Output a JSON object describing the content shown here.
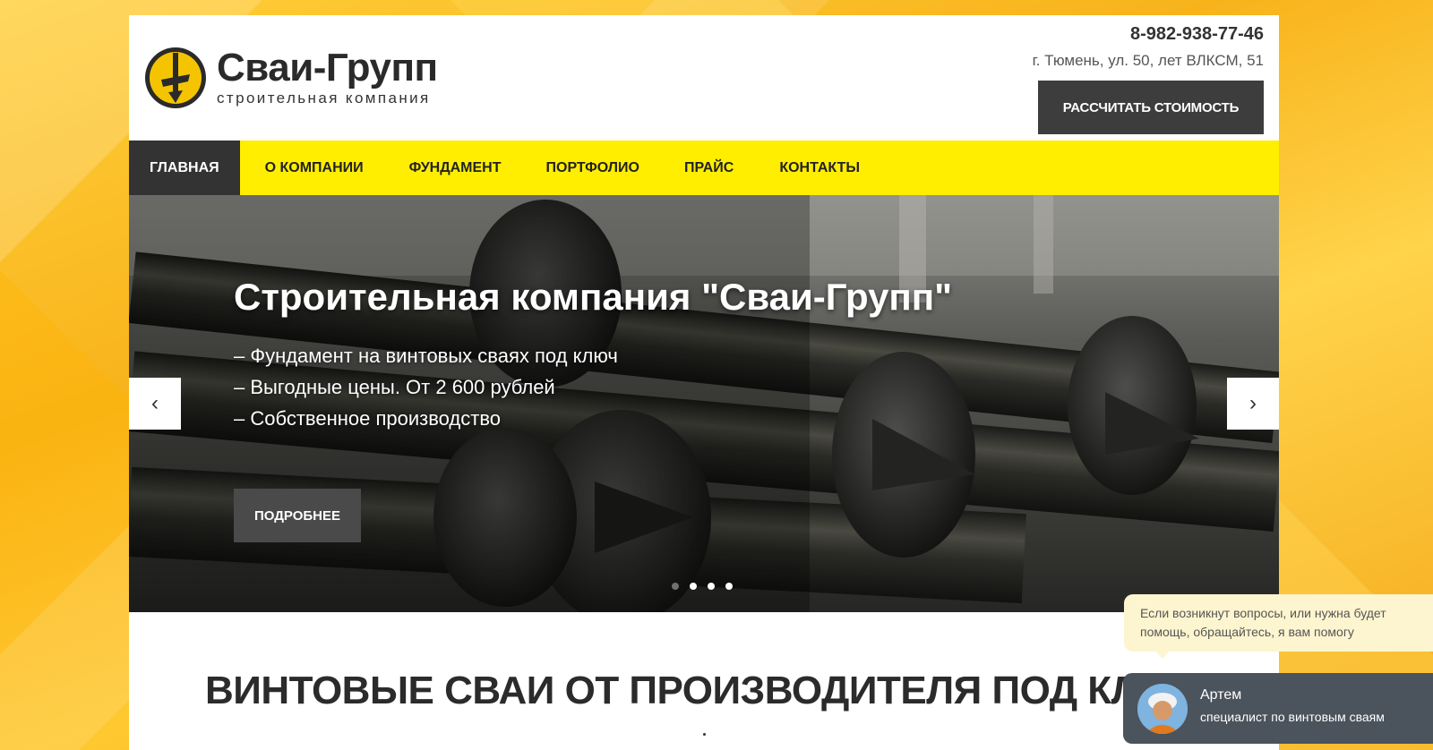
{
  "header": {
    "brand_name": "Сваи-Групп",
    "brand_tagline": "строительная компания",
    "phone": "8-982-938-77-46",
    "address": "г. Тюмень, ул. 50, лет ВЛКСМ, 51",
    "cta_label": "РАССЧИТАТЬ СТОИМОСТЬ"
  },
  "nav": {
    "items": [
      {
        "label": "ГЛАВНАЯ",
        "active": true
      },
      {
        "label": "О КОМПАНИИ",
        "active": false
      },
      {
        "label": "ФУНДАМЕНТ",
        "active": false
      },
      {
        "label": "ПОРТФОЛИО",
        "active": false
      },
      {
        "label": "ПРАЙС",
        "active": false
      },
      {
        "label": "КОНТАКТЫ",
        "active": false
      }
    ]
  },
  "hero": {
    "title": "Строительная компания \"Сваи-Групп\"",
    "bullets": [
      "– Фундамент на винтовых сваях под ключ",
      "– Выгодные цены. От 2 600 рублей",
      "– Собственное производство"
    ],
    "more_label": "ПОДРОБНЕЕ",
    "prev_glyph": "‹",
    "next_glyph": "›",
    "slide_count": 4,
    "active_slide": 1
  },
  "section": {
    "title": "ВИНТОВЫЕ СВАИ ОТ ПРОИЗВОДИТЕЛЯ ПОД КЛЮЧ"
  },
  "chat": {
    "message": "Если возникнут вопросы, или нужна будет помощь, обращайтесь, я вам помогу",
    "agent_name": "Артем",
    "agent_role": "специалист по винтовым сваям"
  },
  "colors": {
    "accent_yellow": "#ffee00",
    "dark": "#333333",
    "chat_panel": "#4b535c",
    "chat_bubble": "#fdf5cf"
  }
}
